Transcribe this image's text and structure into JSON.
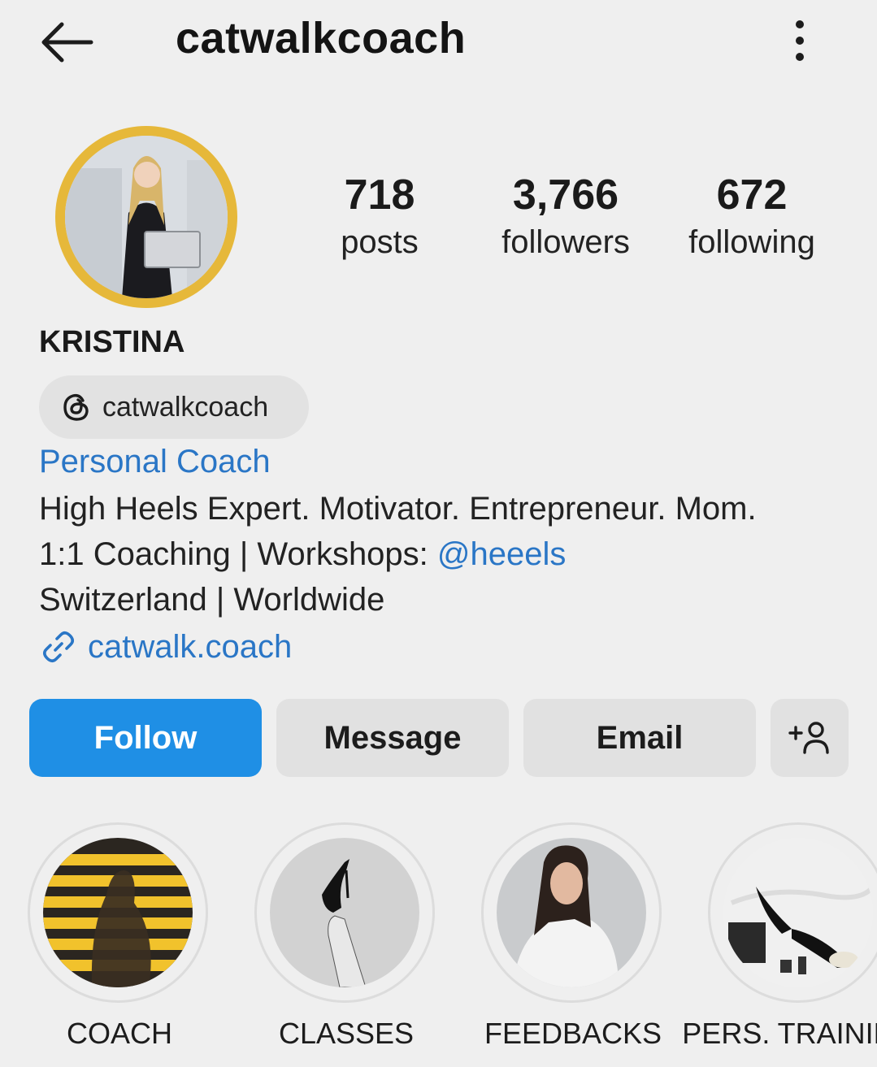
{
  "header": {
    "title": "catwalkcoach",
    "back_icon": "arrow-left-icon",
    "more_icon": "more-vertical-icon"
  },
  "stats": [
    {
      "value": "718",
      "label": "posts"
    },
    {
      "value": "3,766",
      "label": "followers"
    },
    {
      "value": "672",
      "label": "following"
    }
  ],
  "profile": {
    "name": "KRISTINA",
    "threads_handle": "catwalkcoach",
    "category": "Personal Coach",
    "bio_line1": "High Heels Expert. Motivator. Entrepreneur. Mom.",
    "bio_line2_prefix": "1:1 Coaching | Workshops: ",
    "bio_line2_mention": "@heeels",
    "bio_line3": "Switzerland | Worldwide",
    "link": "catwalk.coach",
    "avatar_ring_color": "#e6b83a"
  },
  "actions": {
    "follow": "Follow",
    "message": "Message",
    "email": "Email",
    "add_icon": "add-person-icon",
    "follow_color": "#1f8fe5"
  },
  "highlights": [
    {
      "label": "COACH"
    },
    {
      "label": "CLASSES"
    },
    {
      "label": "FEEDBACKS"
    },
    {
      "label": "PERS. TRAINING"
    }
  ]
}
